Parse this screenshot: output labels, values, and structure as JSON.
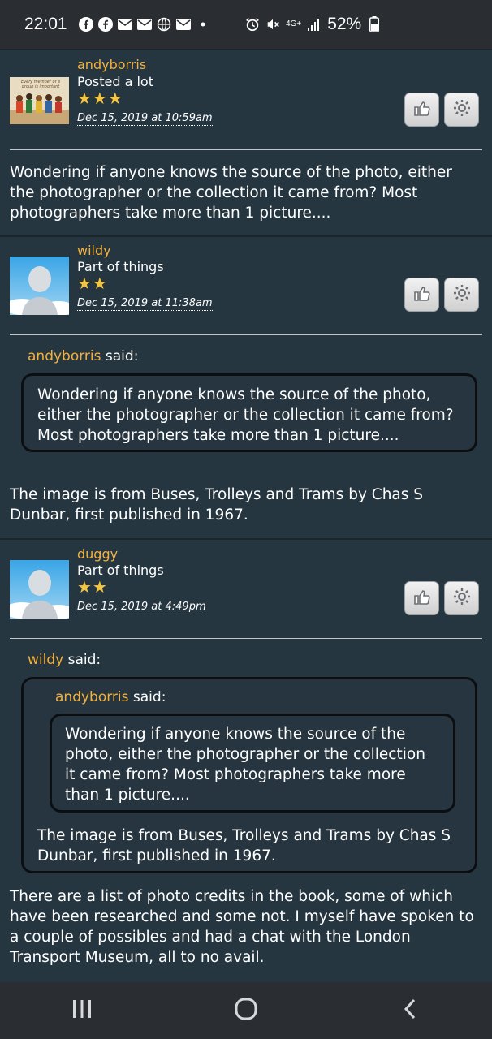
{
  "status_bar": {
    "time": "22:01",
    "battery": "52%",
    "network": "4G+",
    "icons": [
      "facebook-icon",
      "facebook-icon",
      "mail-icon",
      "mail-icon",
      "globe-icon",
      "mail-icon",
      "dot-icon",
      "alarm-icon",
      "mute-icon",
      "signal-icon",
      "battery-icon"
    ]
  },
  "posts": [
    {
      "username": "andyborris",
      "rank": "Posted a lot",
      "stars": "★★★",
      "star_count": 3,
      "date": "Dec 15, 2019 at 10:59am",
      "avatar_caption": "Every member of a group is important",
      "body": "Wondering if anyone knows the source of the photo, either the photographer or the collection it came from? Most photographers take more than 1 picture...."
    },
    {
      "username": "wildy",
      "rank": "Part of things",
      "stars": "★★",
      "star_count": 2,
      "date": "Dec 15, 2019 at 11:38am",
      "quote_author": "andyborris",
      "quote_said": " said:",
      "quote_text": "Wondering if anyone knows the source of the photo, either the photographer or the collection it came from? Most photographers take more than 1 picture....",
      "body": "The image is from Buses, Trolleys and Trams by Chas S Dunbar, first published in 1967."
    },
    {
      "username": "duggy",
      "rank": "Part of things",
      "stars": "★★",
      "star_count": 2,
      "date": "Dec 15, 2019 at 4:49pm",
      "quote_author": "wildy",
      "quote_said": " said:",
      "nested_quote_author": "andyborris",
      "nested_quote_said": " said:",
      "nested_quote_text": "Wondering if anyone knows the source of the photo, either the photographer or the collection it came from? Most photographers take more than 1 picture....",
      "quote_text": "The image is from Buses, Trolleys and Trams by Chas S Dunbar, first published in 1967.",
      "body": "There are a list of photo credits in the book, some of which have been researched and some not. I myself have spoken to a couple of possibles and had a chat with the London Transport Museum, all to no avail."
    }
  ],
  "buttons": {
    "like_icon": "thumbs-up-icon",
    "settings_icon": "gear-icon"
  },
  "nav": [
    "recent-apps-icon",
    "home-icon",
    "back-icon"
  ]
}
